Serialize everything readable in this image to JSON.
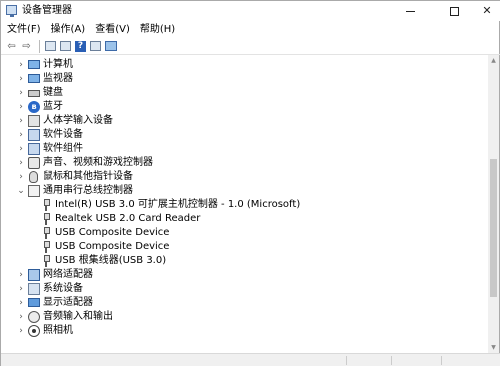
{
  "window": {
    "title": "设备管理器",
    "minimize_glyph": "",
    "maximize_glyph": "",
    "close_glyph": "✕"
  },
  "menu": {
    "items": [
      "文件(F)",
      "操作(A)",
      "查看(V)",
      "帮助(H)"
    ]
  },
  "toolbar": {
    "back_glyph": "⇦",
    "forward_glyph": "⇨",
    "help_glyph": "?"
  },
  "tree": {
    "expanded_glyph": "⌄",
    "collapsed_glyph": "›",
    "categories": [
      {
        "label": "计算机",
        "icon": "computer-icon"
      },
      {
        "label": "监视器",
        "icon": "monitor-icon"
      },
      {
        "label": "键盘",
        "icon": "keyboard-icon"
      },
      {
        "label": "蓝牙",
        "icon": "bluetooth-icon"
      },
      {
        "label": "人体学输入设备",
        "icon": "hid-icon"
      },
      {
        "label": "软件设备",
        "icon": "software-device-icon"
      },
      {
        "label": "软件组件",
        "icon": "software-component-icon"
      },
      {
        "label": "声音、视频和游戏控制器",
        "icon": "speaker-icon"
      },
      {
        "label": "鼠标和其他指针设备",
        "icon": "mouse-icon"
      },
      {
        "label": "通用串行总线控制器",
        "icon": "usb-controller-icon"
      },
      {
        "label": "网络适配器",
        "icon": "network-adapter-icon"
      },
      {
        "label": "系统设备",
        "icon": "system-device-icon"
      },
      {
        "label": "显示适配器",
        "icon": "display-adapter-icon"
      },
      {
        "label": "音频输入和输出",
        "icon": "audio-io-icon"
      },
      {
        "label": "照相机",
        "icon": "camera-icon"
      }
    ],
    "usb_children": [
      {
        "label": "Intel(R) USB 3.0 可扩展主机控制器 - 1.0 (Microsoft)"
      },
      {
        "label": "Realtek USB 2.0 Card Reader"
      },
      {
        "label": "USB Composite Device"
      },
      {
        "label": "USB Composite Device"
      },
      {
        "label": "USB 根集线器(USB 3.0)"
      }
    ]
  },
  "bluetooth_glyph": "ʙ"
}
